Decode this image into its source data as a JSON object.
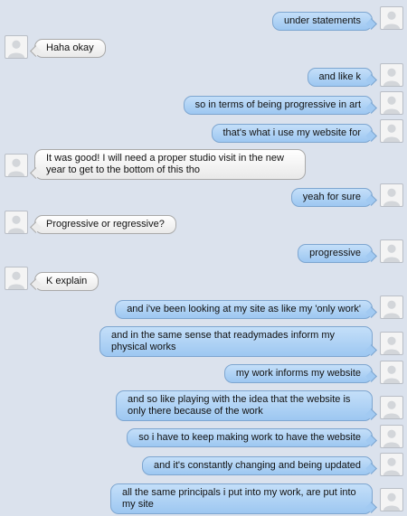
{
  "conversation": {
    "messages": [
      {
        "from": "me",
        "text": "under statements"
      },
      {
        "from": "them",
        "text": "Haha okay"
      },
      {
        "from": "me",
        "text": "and like k"
      },
      {
        "from": "me",
        "text": "so in terms of being progressive in art"
      },
      {
        "from": "me",
        "text": "that's what i use my website for"
      },
      {
        "from": "them",
        "text": "It was good! I will need a proper studio visit in the new year to get to the bottom of this tho"
      },
      {
        "from": "me",
        "text": "yeah for sure"
      },
      {
        "from": "them",
        "text": "Progressive or regressive?"
      },
      {
        "from": "me",
        "text": "progressive"
      },
      {
        "from": "them",
        "text": "K explain"
      },
      {
        "from": "me",
        "text": "and i've been looking at my site as like my 'only work'"
      },
      {
        "from": "me",
        "text": "and in the same sense that readymades inform my physical works"
      },
      {
        "from": "me",
        "text": "my work informs my website"
      },
      {
        "from": "me",
        "text": "and so like playing with the idea that the website is only there because of the work"
      },
      {
        "from": "me",
        "text": "so i have to keep making work to have the website"
      },
      {
        "from": "me",
        "text": "and it's constantly changing and being updated"
      },
      {
        "from": "me",
        "text": "all the same principals i put into my work, are put into my site"
      }
    ]
  },
  "icons": {
    "avatar": "person-silhouette-icon"
  },
  "colors": {
    "background": "#dbe2ed",
    "outgoing_bubble": "#a9cff4",
    "incoming_bubble": "#f2f2f2"
  }
}
